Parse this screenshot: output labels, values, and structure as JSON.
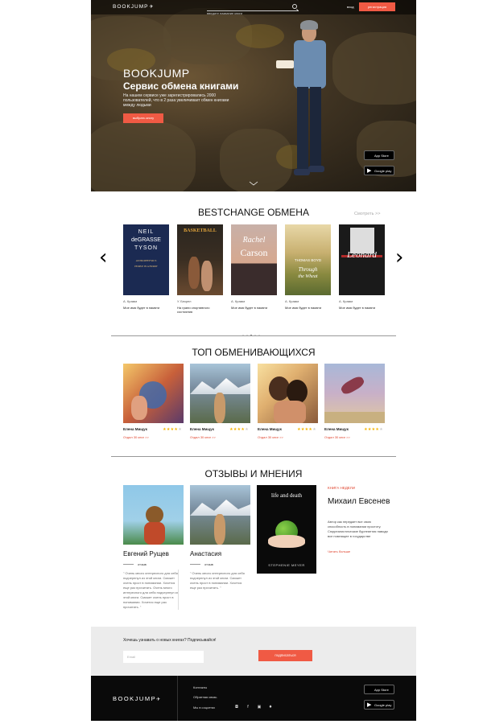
{
  "header": {
    "logo": "BOOKJUMP",
    "search_placeholder": "введите название книги",
    "login": "вход",
    "register": "регистрация"
  },
  "hero": {
    "title": "BOOKJUMP",
    "subtitle": "Сервис обмена книгами",
    "description": "На нашем сервисе уже зарегистрировались 2000 пользователей, что в 2 раза увеличивает обмен книгами между людьми",
    "cta": "выбрать книгу",
    "app_store": "App Store",
    "google_play": "Google play"
  },
  "bestchange": {
    "title": "BESTCHANGE  ОБМЕНА",
    "see_more": "Смотреть >>",
    "books": [
      {
        "author": "А. Крамм",
        "title": "Мое имя будет в памяти",
        "cover_text": [
          "NEIL",
          "deGRASSE",
          "TYSON",
          "ASTROPHYSICS",
          "PEOPLE IN A HURRY"
        ],
        "color": "#1b2a52"
      },
      {
        "author": "У. Бекрел",
        "title": "На грани спортивного состояния",
        "cover_text": [
          "BASKETBALL"
        ],
        "color": "#2b2620"
      },
      {
        "author": "А. Крамм",
        "title": "Мое имя будет в памяти",
        "cover_text": [
          "Rachel",
          "Carson"
        ],
        "color": "#d6a88f"
      },
      {
        "author": "А. Крамм",
        "title": "Мое имя будет в памяти",
        "cover_text": [
          "THOMAS BOYD",
          "Through",
          "the Wheat"
        ],
        "color": "#9b9f5a"
      },
      {
        "author": "А. Крамм",
        "title": "Мое имя будет в памяти",
        "cover_text": [
          "Leonard"
        ],
        "color": "#1a1a1a"
      }
    ]
  },
  "top_traders": {
    "title": "ТОП ОБМЕНИВАЮЩИХСЯ",
    "traders": [
      {
        "name": "Елена Мищук",
        "rating": 4,
        "count": "Отдал 30 книг >>"
      },
      {
        "name": "Елена Мищук",
        "rating": 4,
        "count": "Отдал 30 книг >>"
      },
      {
        "name": "Елена Мищук",
        "rating": 4,
        "count": "Отдал 30 книг >>"
      },
      {
        "name": "Елена Мищук",
        "rating": 4,
        "count": "Отдал 30 книг >>"
      }
    ]
  },
  "reviews": {
    "title": "ОТЗЫВЫ И МНЕНИЯ",
    "items": [
      {
        "name": "Евгений Рущев",
        "label": "отзыв",
        "text": "\" Очень много интересного для себя подчерпнул из этой книги. Сможет очень прост в понимании. Хочется еще раз прочитать. Очень много интересного для себя подчерпнул из этой книги. Сможет очень прост в понимании. Хочется еще раз прочитать. \""
      },
      {
        "name": "Анастасия",
        "label": "отзыв",
        "text": "\" Очень много интересного для себя подчерпнул из этой книги. Сможет очень прост в понимании. Хочется еще раз прочитать. \""
      }
    ],
    "book_of_week": {
      "label": "КНИГА НЕДЕЛИ",
      "author": "Михаил Евсенев",
      "cover_title": "life and death",
      "cover_author": "STEPHENIE MEYER",
      "description": "Автор как передает все свою способность в понимании простоту. Сюрреалистические бурлеянтия наводи все помнящее в государстве",
      "link": "Читать больше"
    }
  },
  "subscribe": {
    "title": "Хочешь узнавать о новых книгах? Подписывайся!",
    "email_placeholder": "Email",
    "button": "подписаться"
  },
  "footer": {
    "logo": "BOOKJUMP",
    "links": [
      "Контакты",
      "Обратная связь",
      "Мы в соцсетях"
    ],
    "social_icons": [
      "instagram-icon",
      "facebook-icon",
      "vk-icon",
      "twitter-icon"
    ],
    "app_store": "App Store",
    "google_play": "Google play"
  },
  "colors": {
    "accent": "#f05a44",
    "star": "#f5b400",
    "link": "#e0442e"
  }
}
